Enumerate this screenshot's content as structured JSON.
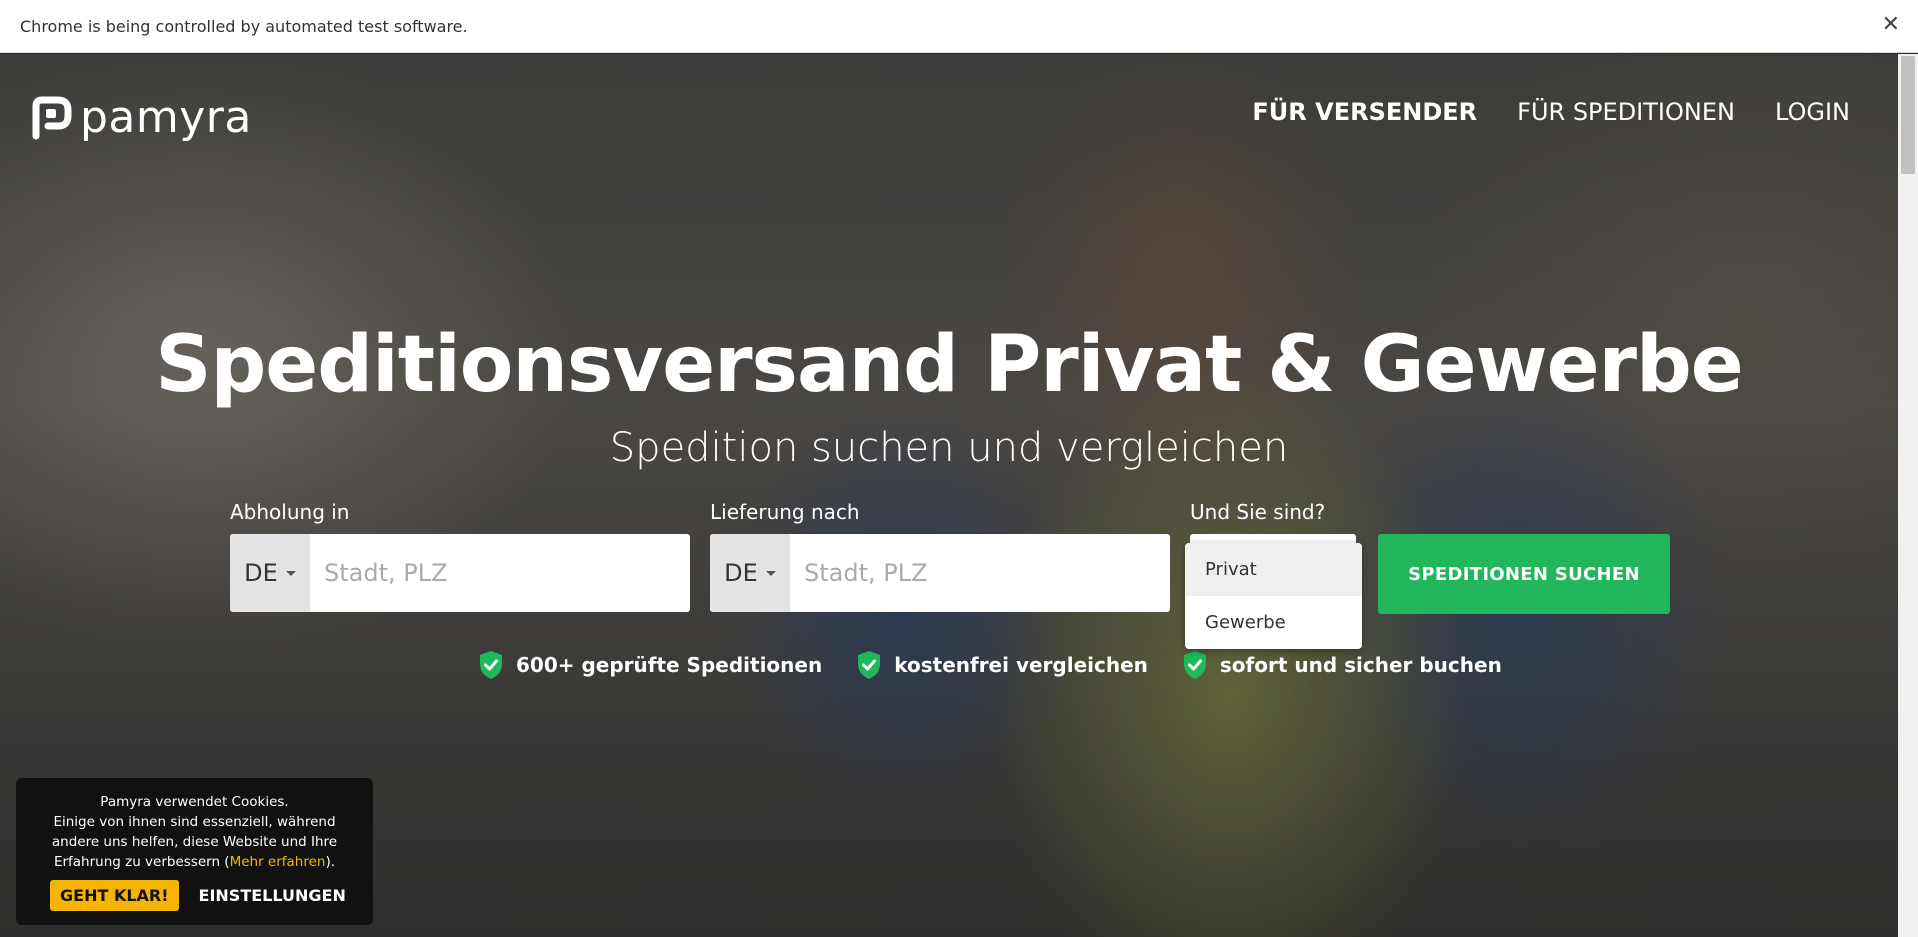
{
  "infobar": {
    "message": "Chrome is being controlled by automated test software.",
    "close_label": "✕"
  },
  "logo": {
    "text": "pamyra"
  },
  "nav": {
    "items": [
      {
        "label": "FÜR VERSENDER"
      },
      {
        "label": "FÜR SPEDITIONEN"
      },
      {
        "label": "LOGIN"
      }
    ]
  },
  "hero": {
    "title": "Speditionsversand Privat & Gewerbe",
    "subtitle": "Spedition suchen und vergleichen"
  },
  "form": {
    "pickup": {
      "label": "Abholung in",
      "country": "DE",
      "placeholder": "Stadt, PLZ"
    },
    "delivery": {
      "label": "Lieferung nach",
      "country": "DE",
      "placeholder": "Stadt, PLZ"
    },
    "customer_type": {
      "label": "Und Sie sind?",
      "options": [
        "Privat",
        "Gewerbe"
      ]
    },
    "search_button": "SPEDITIONEN SUCHEN"
  },
  "badges": [
    {
      "text": "600+ geprüfte Speditionen"
    },
    {
      "text": "kostenfrei vergleichen"
    },
    {
      "text": "sofort und sicher buchen"
    }
  ],
  "cookie": {
    "line1": "Pamyra verwendet Cookies.",
    "line2": "Einige von ihnen sind essenziell, während andere uns helfen, diese Website und Ihre Erfahrung zu verbessern (",
    "link": "Mehr erfahren",
    "line2_end": ").",
    "ok_button": "GEHT KLAR!",
    "settings_button": "EINSTELLUNGEN"
  },
  "colors": {
    "accent_green": "#22b75a",
    "cookie_yellow": "#f5b400"
  }
}
